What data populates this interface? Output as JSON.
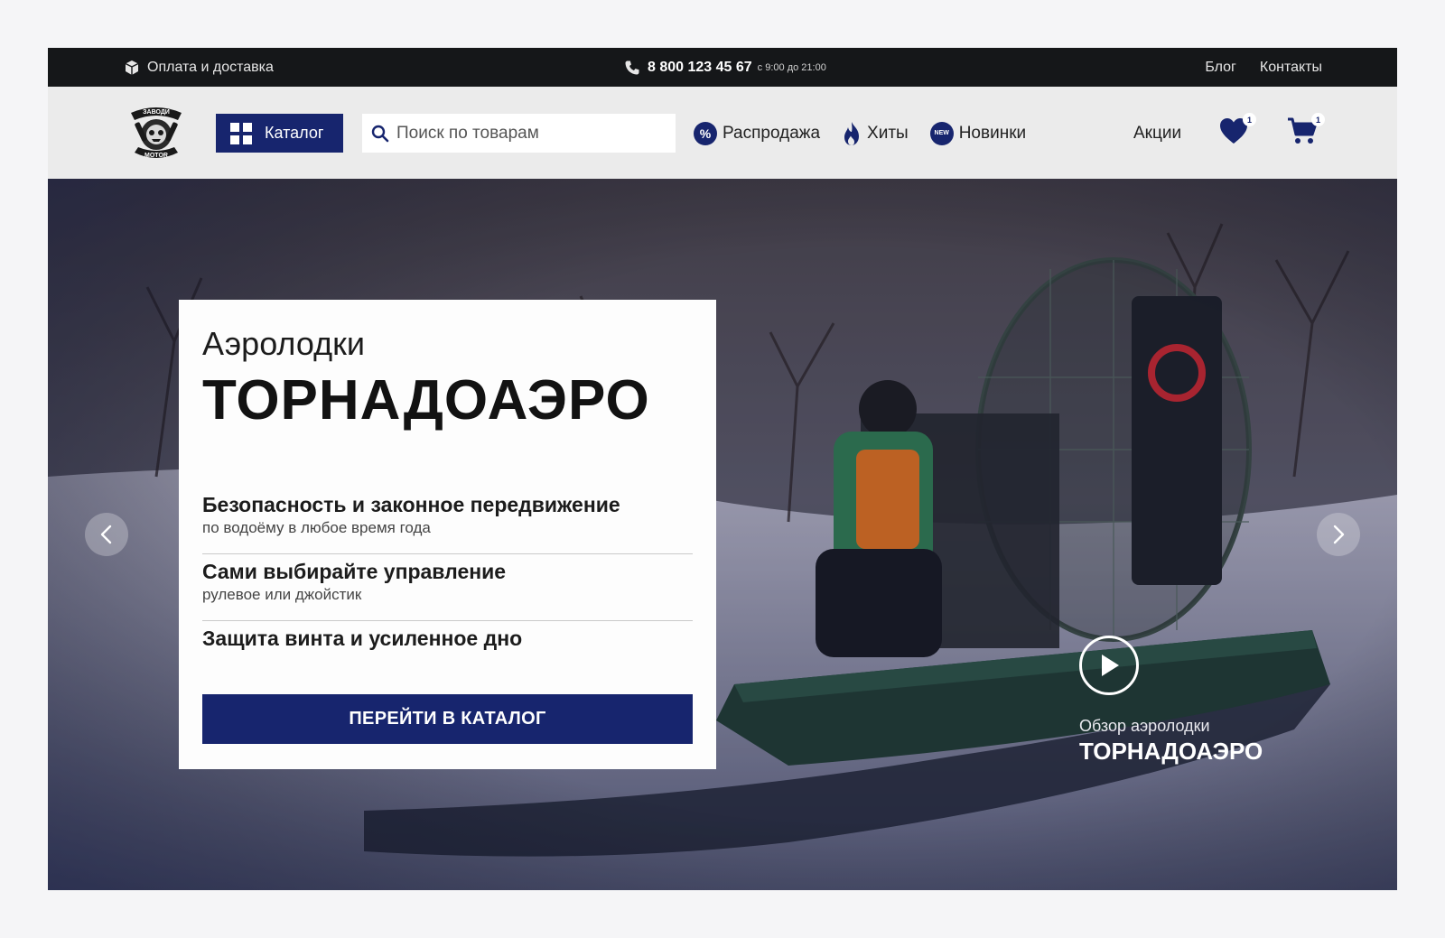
{
  "topbar": {
    "delivery_label": "Оплата и доставка",
    "phone": "8 800 123 45 67",
    "hours": "с 9:00 до 21:00",
    "links": [
      "Блог",
      "Контакты"
    ]
  },
  "header": {
    "logo_top_text": "ЗАВОДИ",
    "logo_bottom_text": "MOTOR",
    "catalog_label": "Каталог",
    "search_placeholder": "Поиск по товарам",
    "nav": [
      {
        "label": "Распродажа",
        "icon": "percent-icon"
      },
      {
        "label": "Хиты",
        "icon": "fire-icon"
      },
      {
        "label": "Новинки",
        "icon": "new-icon",
        "icon_text": "NEW"
      }
    ],
    "promo_label": "Акции",
    "favorites_count": "1",
    "cart_count": "1"
  },
  "hero": {
    "subtitle": "Аэролодки",
    "title": "ТОРНАДОАЭРО",
    "features": [
      {
        "title": "Безопасность и законное передвижение",
        "text": "по водоёму в любое время года"
      },
      {
        "title": "Сами выбирайте управление",
        "text": "рулевое или джойстик"
      },
      {
        "title": "Защита винта и усиленное дно",
        "text": ""
      }
    ],
    "cta_label": "ПЕРЕЙТИ В КАТАЛОГ",
    "video_caption_line1": "Обзор аэролодки",
    "video_caption_line2": "ТОРНАДОАЭРО"
  },
  "colors": {
    "brand": "#17256e",
    "topbar_bg": "#151719",
    "header_bg": "#ebebeb"
  }
}
